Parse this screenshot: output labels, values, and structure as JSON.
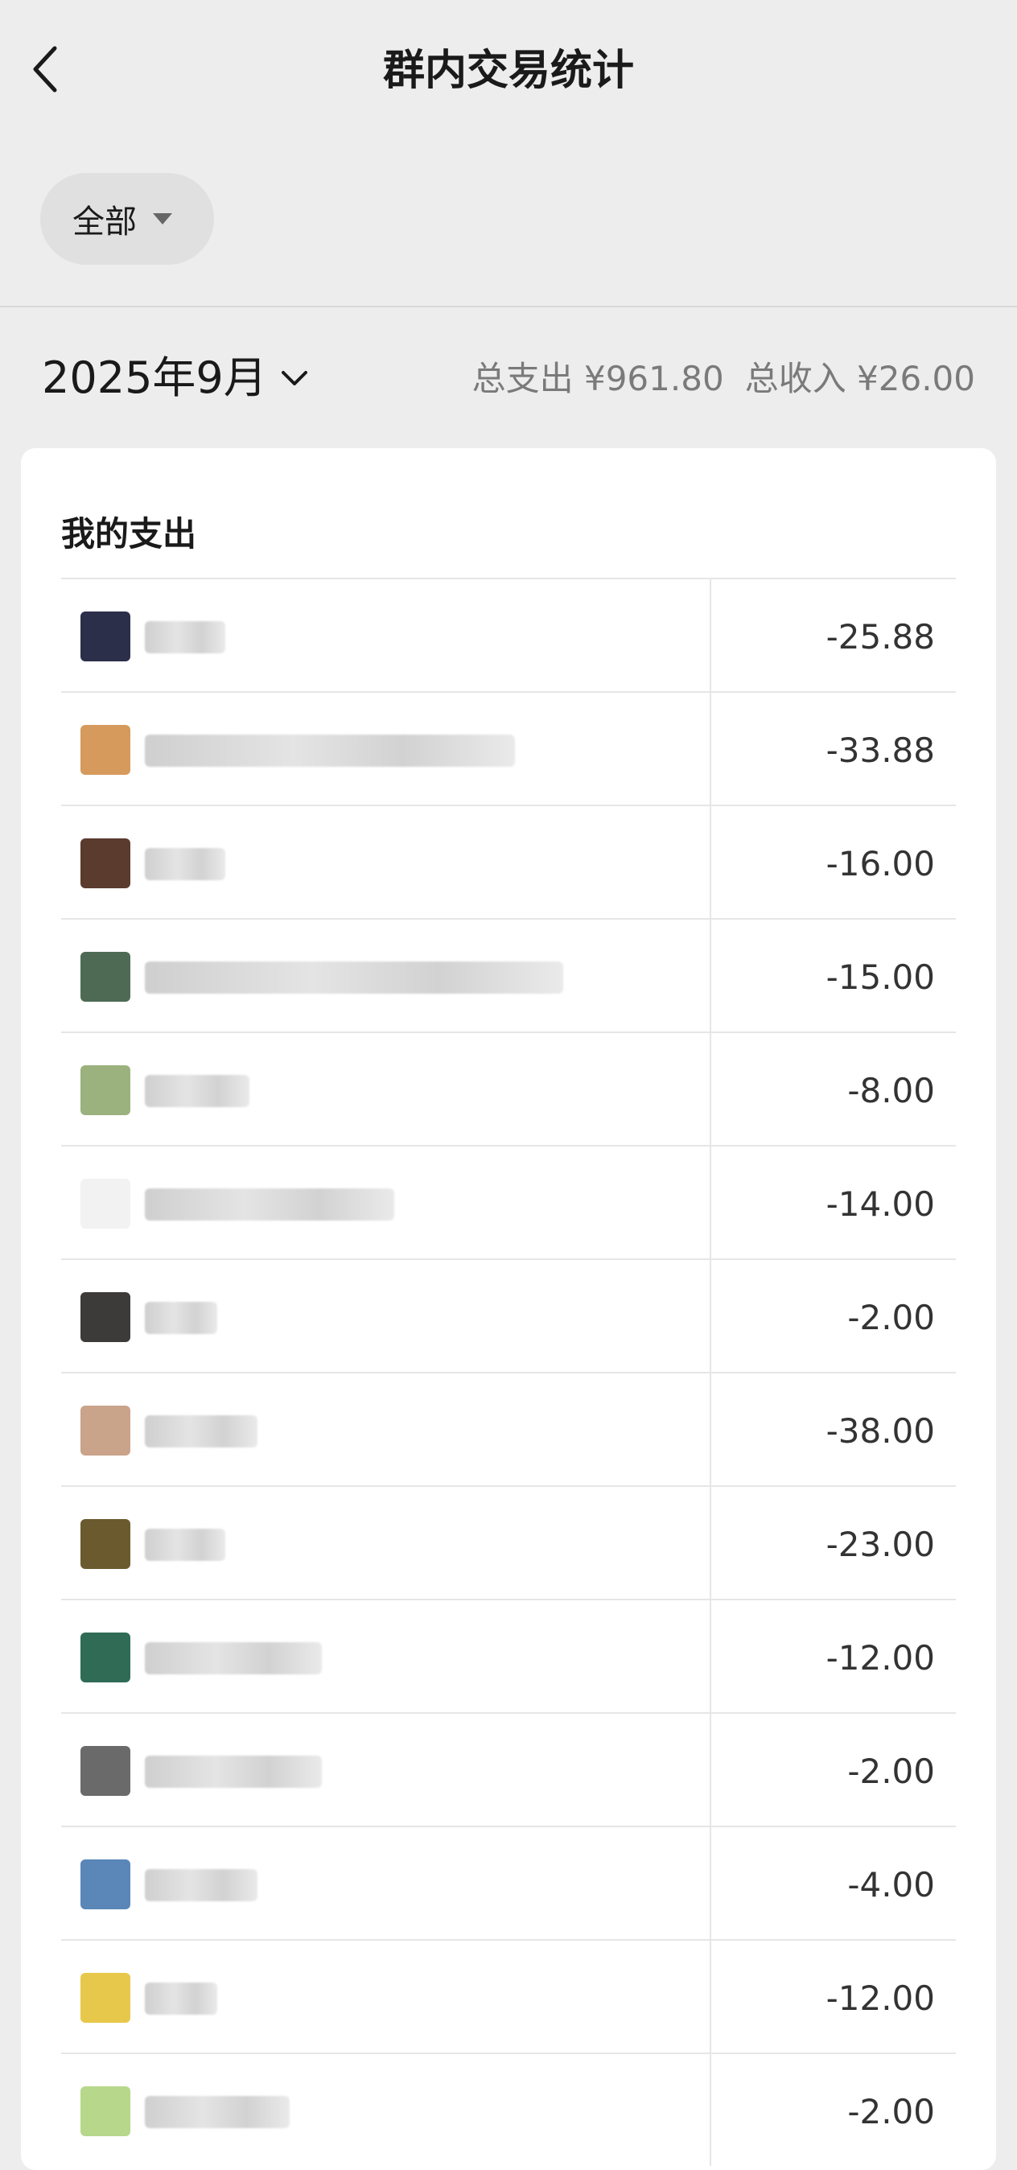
{
  "header": {
    "title": "群内交易统计",
    "back_icon": "chevron-left-icon"
  },
  "filter": {
    "label": "全部",
    "icon": "caret-down-icon"
  },
  "period": {
    "month_label": "2025年9月",
    "icon": "chevron-down-icon"
  },
  "totals": {
    "expense": "总支出 ¥961.80",
    "income": "总收入 ¥26.00"
  },
  "section": {
    "title": "我的支出"
  },
  "rows": [
    {
      "amount": "-25.88",
      "avatar_color": "#2b2f4a"
    },
    {
      "amount": "-33.88",
      "avatar_color": "#d59a5c"
    },
    {
      "amount": "-16.00",
      "avatar_color": "#5a3b2e"
    },
    {
      "amount": "-15.00",
      "avatar_color": "#4e6a55"
    },
    {
      "amount": "-8.00",
      "avatar_color": "#9bb17e"
    },
    {
      "amount": "-14.00",
      "avatar_color": "#f2f2f2"
    },
    {
      "amount": "-2.00",
      "avatar_color": "#3d3a3a"
    },
    {
      "amount": "-38.00",
      "avatar_color": "#c9a38a"
    },
    {
      "amount": "-23.00",
      "avatar_color": "#6b5a2e"
    },
    {
      "amount": "-12.00",
      "avatar_color": "#2f6b55"
    },
    {
      "amount": "-2.00",
      "avatar_color": "#6a6a6a"
    },
    {
      "amount": "-4.00",
      "avatar_color": "#5a86b8"
    },
    {
      "amount": "-12.00",
      "avatar_color": "#e7c84a"
    },
    {
      "amount": "-2.00",
      "avatar_color": "#b7d88a"
    }
  ]
}
